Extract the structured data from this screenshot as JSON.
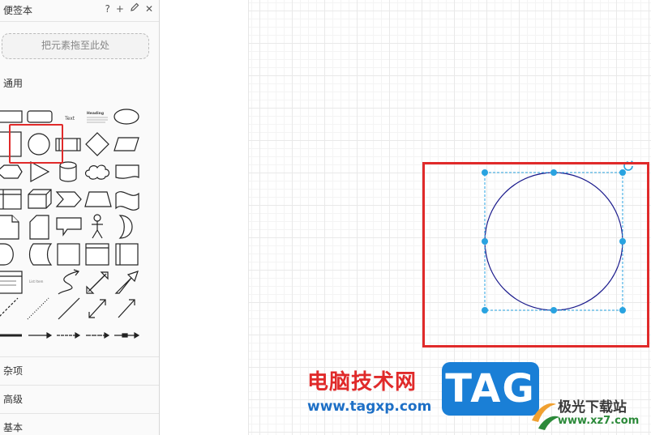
{
  "sidebar": {
    "title": "便签本",
    "actions": {
      "help": "?",
      "add": "+",
      "edit_icon": "pencil-icon",
      "close": "✕"
    },
    "dropzone_text": "把元素拖至此处",
    "general_label": "通用",
    "misc_label": "杂项",
    "advanced_label": "高级",
    "basic_label": "基本",
    "shape_text_label": "Text",
    "shape_heading_label": "Heading",
    "shape_list_label": "List Item"
  },
  "watermark": {
    "site_cn": "电脑技术网",
    "site_url": "www.tagxp.com",
    "tag_logo": "TAG",
    "brand_cn": "极光下载站",
    "brand_url": "www.xz7.com"
  },
  "colors": {
    "highlight": "#e02a2a",
    "selection_handle": "#29a3e0",
    "circle_stroke": "#1a1a8c",
    "tag_blue": "#1a7fd6"
  }
}
